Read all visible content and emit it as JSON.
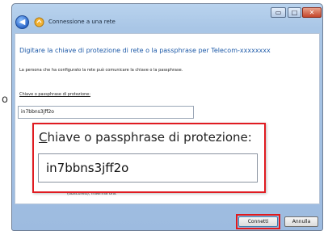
{
  "stray_char": "o",
  "window": {
    "title": "Connessione a una rete",
    "controls": {
      "minimize": "▭",
      "maximize": "□",
      "close": "✕"
    }
  },
  "content": {
    "heading": "Digitare la chiave di protezione di rete o la passphrase per Telecom-xxxxxxxx",
    "description": "La persona che ha configurato la rete può comunicare la chiave o la passphrase.",
    "key_label_small": "Chiave o passphrase di protezione:",
    "key_value_small": "in7bbns3jff2o",
    "partial_text": "(obscured), inserirla ora."
  },
  "zoom": {
    "label_first": "C",
    "label_rest": "hiave o passphrase di protezione:",
    "key_value": "in7bbns3jff2o"
  },
  "buttons": {
    "connect": "Connetti",
    "cancel": "Annulla"
  },
  "colors": {
    "highlight": "#e01b21",
    "heading": "#1e5aa8",
    "frame": "#a9c6e6"
  },
  "icons": {
    "back": "back-arrow-icon",
    "network": "wireless-network-icon"
  }
}
